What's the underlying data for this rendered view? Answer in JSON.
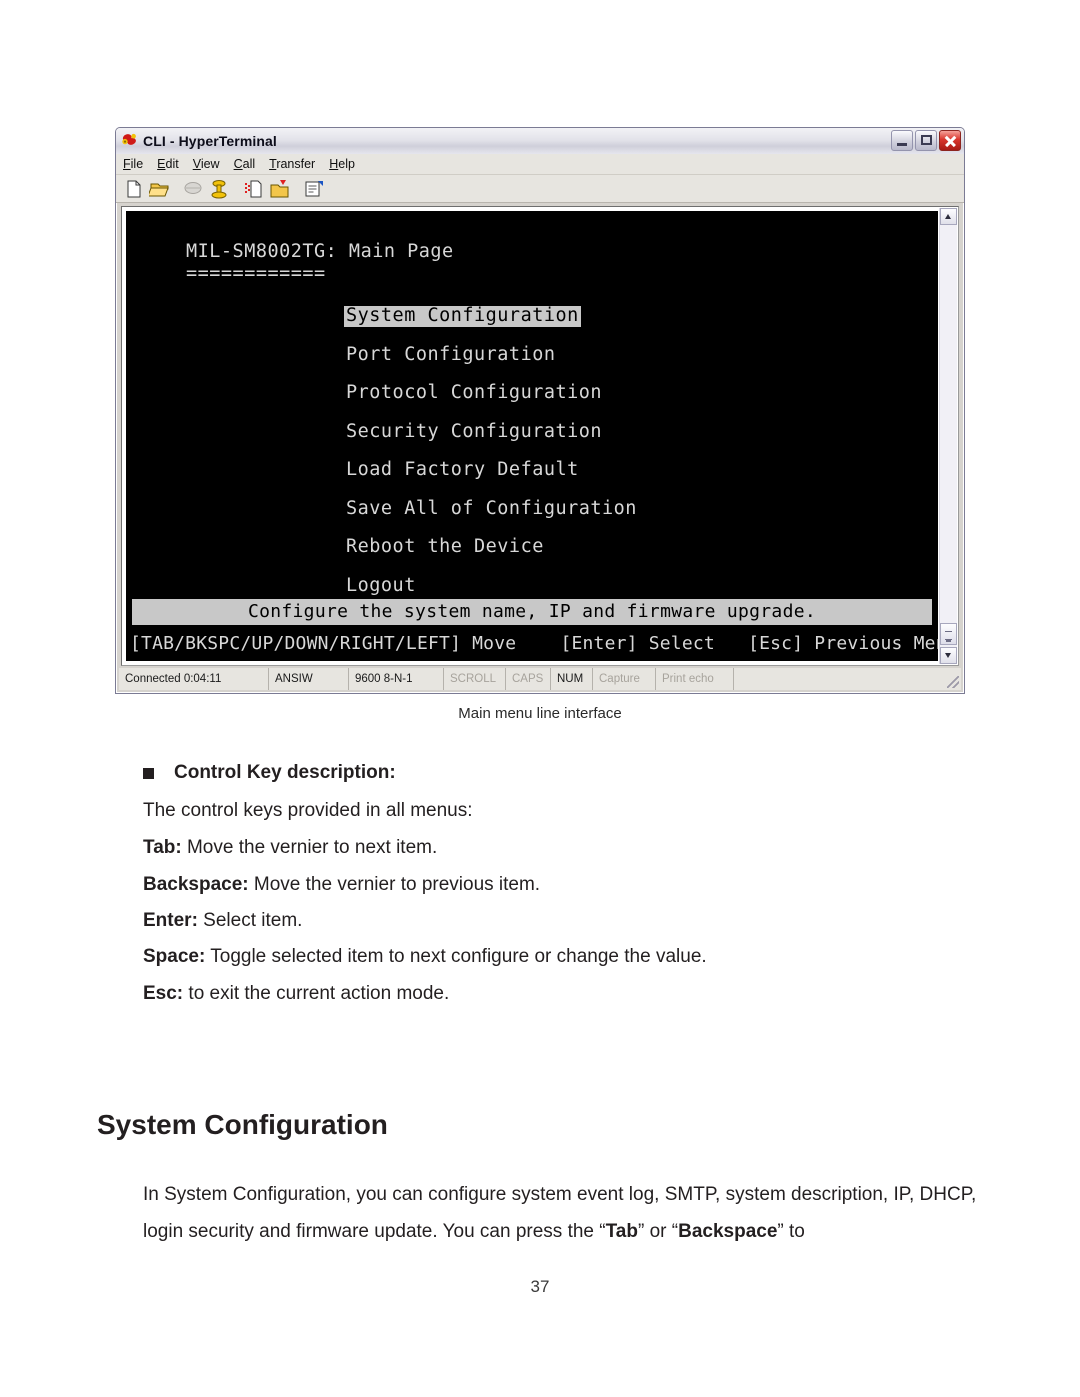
{
  "window": {
    "title": "CLI - HyperTerminal",
    "title_icon": "hyperterminal-phone-icon",
    "menus": [
      {
        "pre": "F",
        "acc": "i",
        "post": "le"
      },
      {
        "pre": "",
        "acc": "E",
        "post": "dit"
      },
      {
        "pre": "",
        "acc": "V",
        "post": "iew"
      },
      {
        "pre": "",
        "acc": "C",
        "post": "all"
      },
      {
        "pre": "",
        "acc": "T",
        "post": "ransfer"
      },
      {
        "pre": "",
        "acc": "H",
        "post": "elp"
      }
    ],
    "menu_labels": [
      "File",
      "Edit",
      "View",
      "Call",
      "Transfer",
      "Help"
    ],
    "toolbar_icons": [
      "new-connection-icon",
      "open-icon",
      "disconnect-icon",
      "call-icon",
      "send-file-icon",
      "receive-file-icon",
      "properties-icon"
    ],
    "controls": {
      "minimize": "Minimize",
      "maximize": "Maximize",
      "close": "Close"
    }
  },
  "terminal": {
    "header": "MIL-SM8002TG: Main Page",
    "rule": "============",
    "menu_items": [
      {
        "label": "System Configuration",
        "selected": true
      },
      {
        "label": "Port Configuration",
        "selected": false
      },
      {
        "label": "Protocol Configuration",
        "selected": false
      },
      {
        "label": "Security Configuration",
        "selected": false
      },
      {
        "label": "Load Factory Default",
        "selected": false
      },
      {
        "label": "Save All of Configuration",
        "selected": false
      },
      {
        "label": "Reboot the Device",
        "selected": false
      },
      {
        "label": "Logout",
        "selected": false
      }
    ],
    "description": "Configure the system name, IP and firmware upgrade.",
    "key_hints": "[TAB/BKSPC/UP/DOWN/RIGHT/LEFT] Move    [Enter] Select   [Esc] Previous Menu"
  },
  "statusbar": {
    "connected": "Connected 0:04:11",
    "emulation": "ANSIW",
    "line_settings": "9600 8-N-1",
    "scroll": "SCROLL",
    "caps": "CAPS",
    "num": "NUM",
    "capture": "Capture",
    "print_echo": "Print echo"
  },
  "document": {
    "figure_caption": "Main menu line interface",
    "bullet_heading": "Control Key description:",
    "intro": "The control keys provided in all menus:",
    "keys": [
      {
        "key": "Tab:",
        "desc": " Move the vernier to next item."
      },
      {
        "key": "Backspace:",
        "desc": " Move the vernier to previous item."
      },
      {
        "key": "Enter:",
        "desc": " Select item."
      },
      {
        "key": "Space:",
        "desc": " Toggle selected item to next configure or change the value."
      },
      {
        "key": "Esc:",
        "desc": " to exit the current action mode."
      }
    ],
    "section_heading": "System Configuration",
    "paragraph": {
      "part1": "In System Configuration, you can configure system event log, SMTP, system description, IP, DHCP, login security and firmware update. You can press the “",
      "bold1": "Tab",
      "mid": "” or “",
      "bold2": "Backspace",
      "part2": "” to"
    },
    "page_number": "37"
  }
}
